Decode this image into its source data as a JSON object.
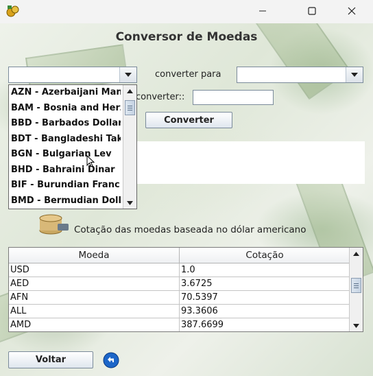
{
  "window": {
    "title": "",
    "controls": [
      "minimize-icon",
      "maximize-icon",
      "close-icon"
    ]
  },
  "heading": "Conversor de Moedas",
  "from_currency": {
    "value": "",
    "options": [
      "AZN - Azerbaijani Manat",
      "BAM - Bosnia and Herzegovina Convertible Mark",
      "BBD - Barbados Dollar",
      "BDT - Bangladeshi Taka",
      "BGN - Bulgarian Lev",
      "BHD - Bahraini Dinar",
      "BIF - Burundian Franc",
      "BMD - Bermudian Dollar"
    ]
  },
  "converter_para_label": "converter para",
  "to_currency": {
    "value": ""
  },
  "amount_label": "converter::",
  "amount_value": "",
  "converter_button": "Converter",
  "info_text": "Cotação das moedas baseada no dólar americano",
  "table": {
    "headers": [
      "Moeda",
      "Cotação"
    ],
    "rows": [
      [
        "USD",
        "1.0"
      ],
      [
        "AED",
        "3.6725"
      ],
      [
        "AFN",
        "70.5397"
      ],
      [
        "ALL",
        "93.3606"
      ],
      [
        "AMD",
        "387.6699"
      ]
    ]
  },
  "voltar_button": "Voltar",
  "icons": [
    "app-icon",
    "back-arrow-icon",
    "coin-stack-icon",
    "combo-arrow-icon",
    "mouse-cursor-icon"
  ]
}
